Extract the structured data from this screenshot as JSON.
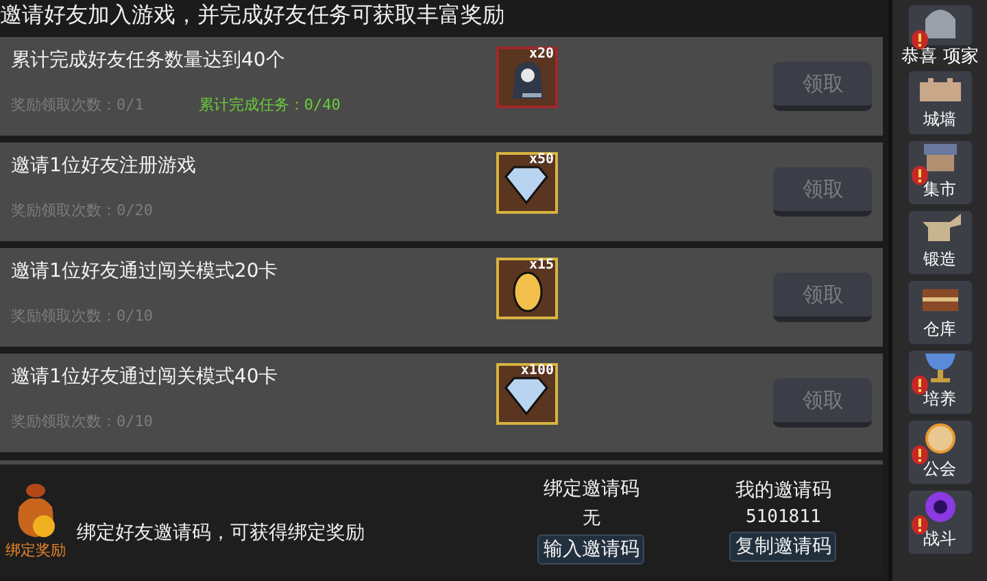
{
  "header": "邀请好友加入游戏，并完成好友任务可获取丰富奖励",
  "tasks": [
    {
      "title": "累计完成好友任务数量达到40个",
      "claims": "奖励领取次数：0/1",
      "progress": {
        "text": "累计完成任务：0/40",
        "color": "#6ccc3a"
      },
      "reward": {
        "kind": "hood",
        "count": "x20",
        "color": "#a0282c"
      },
      "button": "领取",
      "disabled": true
    },
    {
      "title": "邀请1位好友注册游戏",
      "claims": "奖励领取次数：0/20",
      "reward": {
        "kind": "diamond",
        "count": "x50",
        "color": "#d8b440"
      },
      "button": "领取",
      "disabled": true
    },
    {
      "title": "邀请1位好友通过闯关模式20卡",
      "claims": "奖励领取次数：0/10",
      "reward": {
        "kind": "egg",
        "count": "x15",
        "color": "#d8b440"
      },
      "button": "领取",
      "disabled": true
    },
    {
      "title": "邀请1位好友通过闯关模式40卡",
      "claims": "奖励领取次数：0/10",
      "reward": {
        "kind": "diamond",
        "count": "x100",
        "color": "#d8b440"
      },
      "button": "领取",
      "disabled": true
    }
  ],
  "bind": {
    "icon_label": "绑定奖励",
    "text": "绑定好友邀请码，可获得绑定奖励",
    "bound_title": "绑定邀请码",
    "bound_value": "无",
    "bound_button": "输入邀请码",
    "my_title": "我的邀请码",
    "my_value": "5101811",
    "my_button": "复制邀请码"
  },
  "toast": "恭喜 项家",
  "sidebar": [
    {
      "kind": "helmet",
      "alert": true
    },
    {
      "kind": "wall",
      "label": "城墙",
      "alert": false
    },
    {
      "kind": "market",
      "label": "集市",
      "alert": true
    },
    {
      "kind": "anvil",
      "label": "锻造",
      "alert": false
    },
    {
      "kind": "chest",
      "label": "仓库",
      "alert": false
    },
    {
      "kind": "chalice",
      "label": "培养",
      "alert": true
    },
    {
      "kind": "guild",
      "label": "公会",
      "alert": true
    },
    {
      "kind": "portal",
      "label": "战斗",
      "alert": true
    }
  ]
}
